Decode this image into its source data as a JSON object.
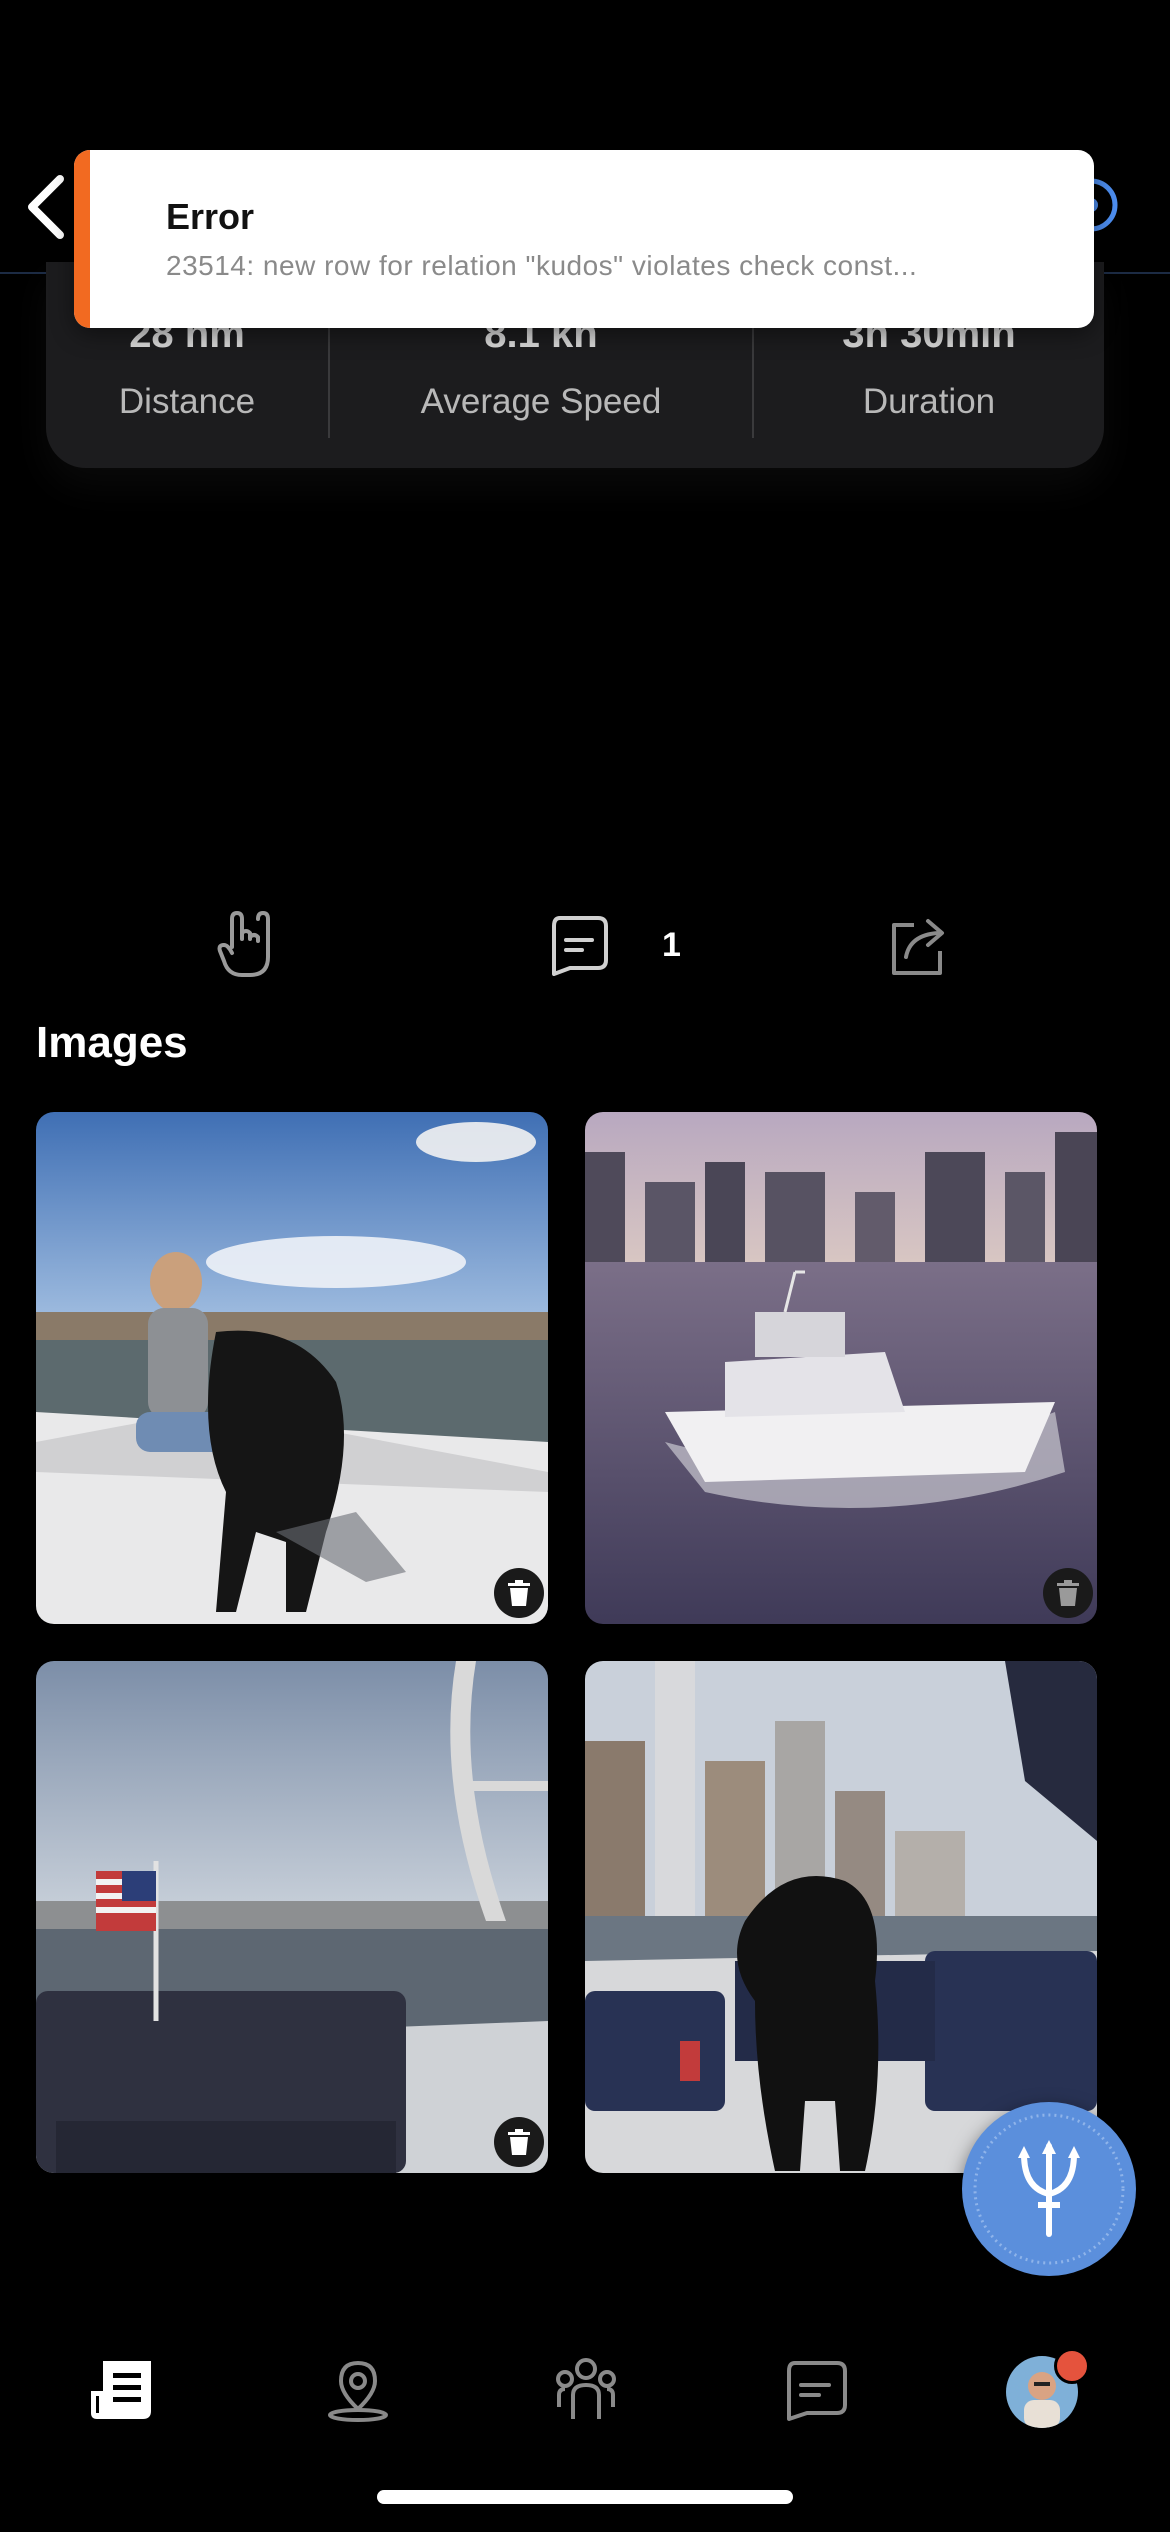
{
  "toast": {
    "title": "Error",
    "message": "23514: new row for relation \"kudos\" violates check const..."
  },
  "stats": [
    {
      "value": "28 nm",
      "label": "Distance"
    },
    {
      "value": "8.1 kn",
      "label": "Average Speed"
    },
    {
      "value": "3h 30min",
      "label": "Duration"
    }
  ],
  "actions": {
    "comment_count": "1"
  },
  "images_section": {
    "title": "Images",
    "photos": [
      {
        "name": "woman-with-dog-on-boat-deck",
        "deletable": true
      },
      {
        "name": "sport-fishing-boat-skyline",
        "deletable": true
      },
      {
        "name": "boat-stern-with-flag",
        "deletable": true
      },
      {
        "name": "dog-on-boat-cockpit",
        "deletable": false
      }
    ]
  },
  "tab_bar": {
    "items": [
      "feed-icon",
      "map-pin-icon",
      "community-icon",
      "messages-icon",
      "profile-avatar"
    ],
    "active": "feed-icon"
  },
  "colors": {
    "toast_accent": "#f26a21",
    "fab": "#5b8fdc",
    "badge": "#e5533d"
  }
}
